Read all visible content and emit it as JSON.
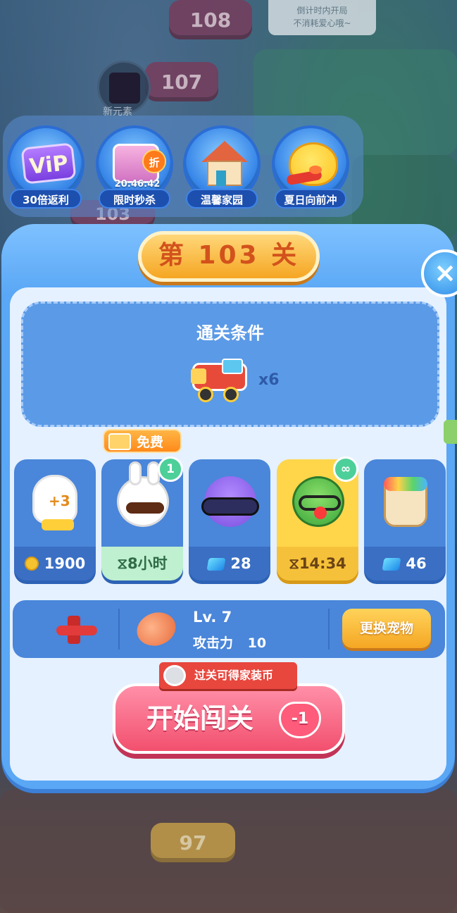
{
  "background": {
    "levels": [
      {
        "number": "108"
      },
      {
        "number": "107"
      },
      {
        "number": "103"
      },
      {
        "number": "97"
      }
    ],
    "tip": {
      "line1": "倒计时内开局",
      "line2": "不消耗爱心哦~"
    },
    "newbie_label": "新元素"
  },
  "top_menu": {
    "items": [
      {
        "label": "30倍返利",
        "icon": "vip-icon"
      },
      {
        "label": "限时秒杀",
        "icon": "gift-icon",
        "timer": "20:46:42",
        "badge": "折"
      },
      {
        "label": "温馨家园",
        "icon": "house-icon"
      },
      {
        "label": "夏日向前冲",
        "icon": "chick-icon"
      }
    ]
  },
  "panel": {
    "title": "第 103 关",
    "close": "×",
    "condition": {
      "title": "通关条件",
      "target_icon": "train-icon",
      "count": "x6"
    },
    "free_tag": "免费",
    "items": [
      {
        "name": "glove",
        "icon_text": "+3",
        "currency": "coin",
        "value": "1900"
      },
      {
        "name": "rabbit",
        "badge": "1",
        "value": "⧖8小时"
      },
      {
        "name": "cat",
        "currency": "gem",
        "value": "28"
      },
      {
        "name": "frog",
        "badge": "∞",
        "value": "⧖14:34"
      },
      {
        "name": "paint-bucket",
        "currency": "gem",
        "value": "46"
      }
    ],
    "pet": {
      "level": "Lv. 7",
      "attack_label": "攻击力",
      "attack_value": "10",
      "change_button": "更换宠物"
    },
    "reward_text": "过关可得家装币",
    "start_button": "开始闯关",
    "heart_cost": "-1"
  },
  "colors": {
    "panel_blue": "#5aa7f5",
    "start_pink": "#f2506e",
    "gold": "#f5a623"
  }
}
